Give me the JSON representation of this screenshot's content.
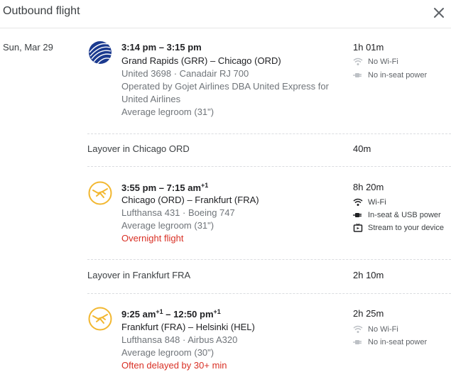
{
  "header": {
    "title": "Outbound flight"
  },
  "date": "Sun, Mar 29",
  "segments": [
    {
      "time": "3:14 pm – 3:15 pm",
      "route": "Grand Rapids (GRR) – Chicago (ORD)",
      "flight": "United 3698 · Canadair RJ 700",
      "operated_1": "Operated by Gojet Airlines DBA United Express for",
      "operated_2": "United Airlines",
      "legroom": "Average legroom (31\")",
      "duration": "1h 01m",
      "amenities": [
        "No Wi-Fi",
        "No in-seat power"
      ]
    },
    {
      "time_dep": "3:55 pm – 7:15 am",
      "time_sup": "+1",
      "route": "Chicago (ORD) – Frankfurt (FRA)",
      "flight": "Lufthansa 431 · Boeing 747",
      "legroom": "Average legroom (31\")",
      "note": "Overnight flight",
      "duration": "8h 20m",
      "amenities": [
        "Wi-Fi",
        "In-seat & USB power",
        "Stream to your device"
      ]
    },
    {
      "time_dep": "9:25 am",
      "time_dep_sup": "+1",
      "time_arr": " – 12:50 pm",
      "time_arr_sup": "+1",
      "route": "Frankfurt (FRA) – Helsinki (HEL)",
      "flight": "Lufthansa 848 · Airbus A320",
      "legroom": "Average legroom (30\")",
      "note": "Often delayed by 30+ min",
      "duration": "2h 25m",
      "amenities": [
        "No Wi-Fi",
        "No in-seat power"
      ]
    }
  ],
  "layovers": [
    {
      "label": "Layover in Chicago ORD",
      "duration": "40m"
    },
    {
      "label": "Layover in Frankfurt FRA",
      "duration": "2h 10m"
    }
  ],
  "icons": {
    "close": "close-icon",
    "united": "united-airlines-logo",
    "lufthansa": "lufthansa-logo",
    "wifi": "wifi-icon",
    "power": "power-plug-icon",
    "stream": "stream-tv-icon"
  },
  "colors": {
    "united_blue": "#1b3a8f",
    "lufthansa_yellow": "#f2b730",
    "red_note": "#d93025",
    "muted": "#70757a"
  }
}
